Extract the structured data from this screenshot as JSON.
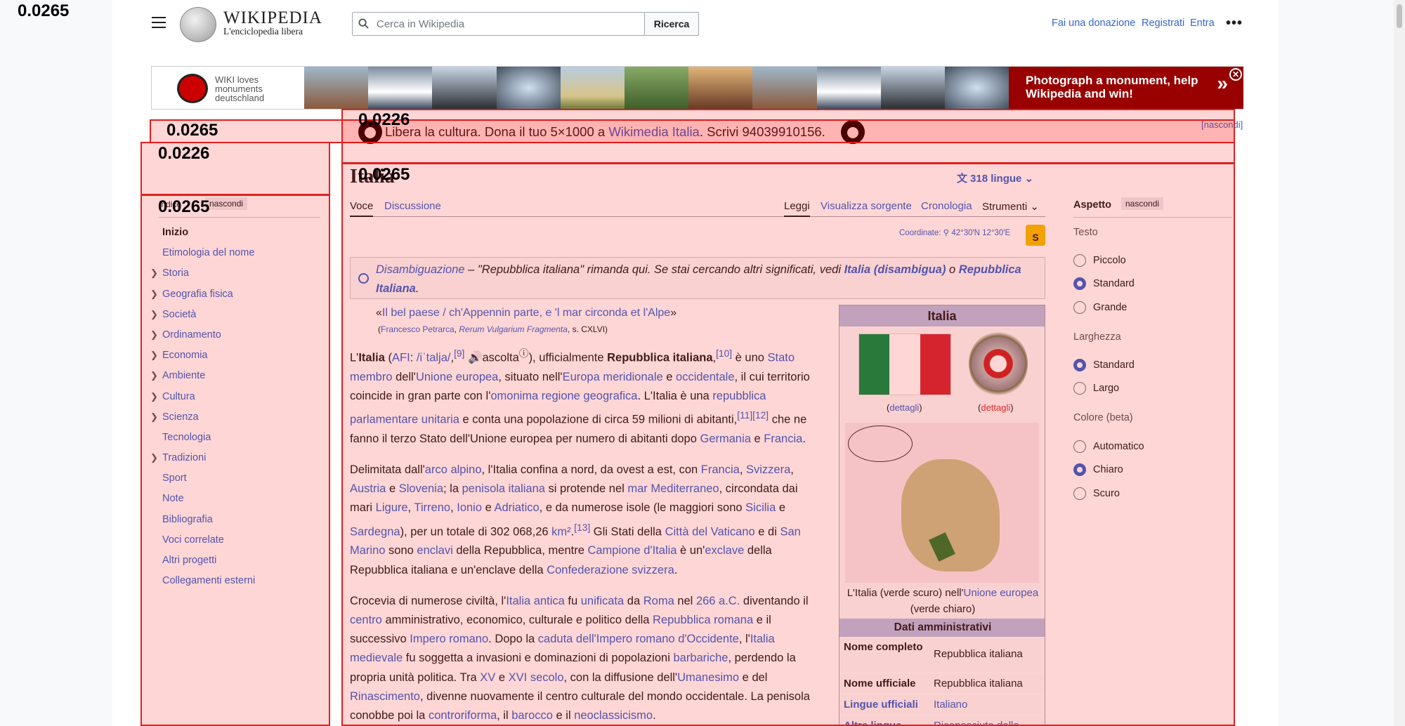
{
  "overlay_labels": {
    "top": "0.0265",
    "notice": "0.0265",
    "sidebar": "0.0226",
    "notice_inner": "0.0226",
    "title": "0.0265",
    "toc": "0.0265"
  },
  "header": {
    "logo_wordmark": "WIKIPEDIA",
    "logo_tagline": "L'enciclopedia libera",
    "search_placeholder": "Cerca in Wikipedia",
    "search_button": "Ricerca",
    "donate": "Fai una donazione",
    "register": "Registrati",
    "login": "Entra",
    "more": "•••"
  },
  "banner": {
    "wlm_line1": "WIKI loves",
    "wlm_line2": "monuments",
    "wlm_line3": "deutschland",
    "cta": "Photograph a monument, help Wikipedia and win!",
    "next": "»",
    "close": "✕"
  },
  "notice": {
    "hide": "[nascondi]",
    "text1": "Libera la cultura. Dona il tuo 5×1000 a ",
    "link": "Wikimedia Italia",
    "text2": ". Scrivi 94039910156."
  },
  "toc": {
    "title": "Indice",
    "hide": "nascondi",
    "items": [
      {
        "label": "Inizio",
        "active": true,
        "arrow": false
      },
      {
        "label": "Etimologia del nome",
        "arrow": false
      },
      {
        "label": "Storia",
        "arrow": true
      },
      {
        "label": "Geografia fisica",
        "arrow": true
      },
      {
        "label": "Società",
        "arrow": true
      },
      {
        "label": "Ordinamento",
        "arrow": true
      },
      {
        "label": "Economia",
        "arrow": true
      },
      {
        "label": "Ambiente",
        "arrow": true
      },
      {
        "label": "Cultura",
        "arrow": true
      },
      {
        "label": "Scienza",
        "arrow": true
      },
      {
        "label": "Tecnologia",
        "arrow": false
      },
      {
        "label": "Tradizioni",
        "arrow": true
      },
      {
        "label": "Sport",
        "arrow": false
      },
      {
        "label": "Note",
        "arrow": false
      },
      {
        "label": "Bibliografia",
        "arrow": false
      },
      {
        "label": "Voci correlate",
        "arrow": false
      },
      {
        "label": "Altri progetti",
        "arrow": false
      },
      {
        "label": "Collegamenti esterni",
        "arrow": false
      }
    ]
  },
  "article": {
    "title": "Italia",
    "languages": "318 lingue",
    "tabs": {
      "voce": "Voce",
      "discussione": "Discussione",
      "leggi": "Leggi",
      "sorgente": "Visualizza sorgente",
      "cronologia": "Cronologia",
      "strumenti": "Strumenti"
    },
    "coord_label": "Coordinate:",
    "coord": "42°30′N 12°30′E",
    "lock": "S",
    "hatnote": {
      "link": "Disambiguazione",
      "text": " – \"Repubblica italiana\" rimanda qui. Se stai cercando altri significati, vedi ",
      "l1": "Italia (disambigua)",
      "o": " o ",
      "l2": "Repubblica Italiana",
      "end": "."
    },
    "quote": "Il bel paese / ch'Appennin parte, e 'l mar circonda et l'Alpe",
    "quote_src1": "Francesco Petrarca",
    "quote_src2": "Rerum Vulgarium Fragmenta",
    "quote_src3": ", s. CXLVI"
  },
  "infobox": {
    "title": "Italia",
    "flag_caption": "dettagli",
    "emblem_caption": "dettagli",
    "map_caption1": "L'Italia (verde scuro) nell'",
    "map_caption_link": "Unione europea",
    "map_caption2": " (verde chiaro)",
    "section": "Dati amministrativi",
    "rows": [
      {
        "k": "Nome completo",
        "v": "Repubblica italiana"
      },
      {
        "k": "Nome ufficiale",
        "v": "Repubblica italiana"
      },
      {
        "k": "Lingue ufficiali",
        "v": "Italiano"
      },
      {
        "k": "Altre lingue",
        "v": "Riconosciute dallo Stato"
      }
    ]
  },
  "appearance": {
    "title": "Aspetto",
    "hide": "nascondi",
    "text_label": "Testo",
    "small": "Piccolo",
    "standard": "Standard",
    "large": "Grande",
    "width_label": "Larghezza",
    "w_standard": "Standard",
    "w_wide": "Largo",
    "color_label": "Colore (beta)",
    "auto": "Automatico",
    "light": "Chiaro",
    "dark": "Scuro"
  },
  "colors": {
    "link": "#3366cc",
    "debug_box": "#e02020",
    "banner_red": "#990000"
  }
}
